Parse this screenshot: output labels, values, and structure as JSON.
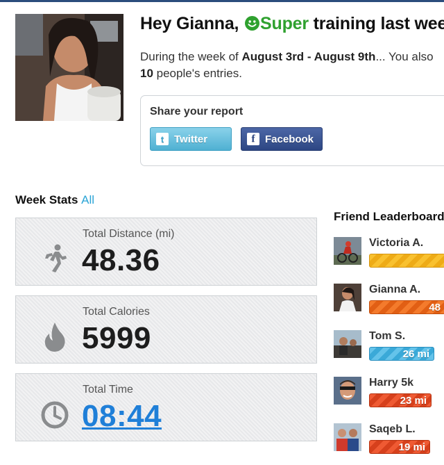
{
  "greeting": {
    "prefix": "Hey Gianna,",
    "super_word": "Super",
    "suffix": "training last week"
  },
  "summary": {
    "line1_prefix": "During the week of ",
    "line1_dates": "August 3rd - August 9th",
    "line1_suffix": "... You also",
    "line2_count": "10",
    "line2_suffix": " people's entries."
  },
  "share": {
    "title": "Share your report",
    "twitter_label": "Twitter",
    "facebook_label": "Facebook"
  },
  "week_stats": {
    "heading": "Week Stats",
    "all_link": "All",
    "cards": [
      {
        "label": "Total Distance (mi)",
        "value": "48.36",
        "icon": "runner-icon"
      },
      {
        "label": "Total Calories",
        "value": "5999",
        "icon": "flame-icon"
      },
      {
        "label": "Total Time",
        "value": "08:44",
        "icon": "clock-icon"
      }
    ]
  },
  "leaderboard": {
    "heading": "Friend Leaderboard",
    "entries": [
      {
        "name": "Victoria A.",
        "value": "",
        "color": "#f9c12f"
      },
      {
        "name": "Gianna A.",
        "value": "48",
        "color": "#f47b2c"
      },
      {
        "name": "Tom S.",
        "value": "26 mi",
        "color": "#3aa9d8"
      },
      {
        "name": "Harry 5k",
        "value": "23 mi",
        "color": "#ef5a33"
      },
      {
        "name": "Saqeb L.",
        "value": "19 mi",
        "color": "#ef5a33"
      }
    ]
  },
  "colors": {
    "accent_green": "#2fa12f",
    "link_blue": "#2aa4d6",
    "facebook_blue": "#2d4683",
    "twitter_blue": "#4fb0d2"
  }
}
